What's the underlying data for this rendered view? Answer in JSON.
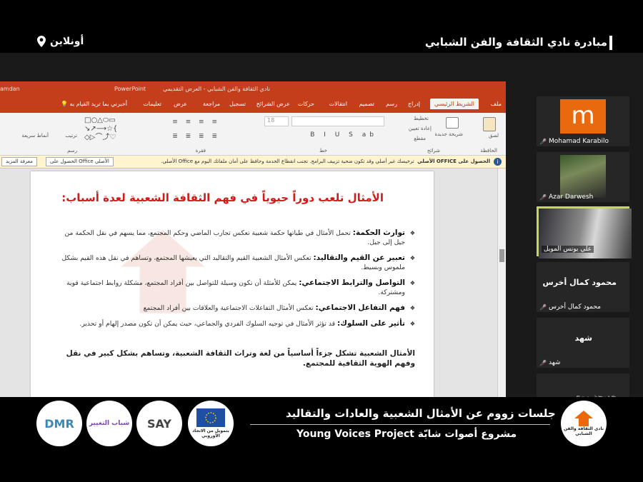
{
  "header": {
    "title": "مبادرة نادي الثقافة والفن الشبابي",
    "online": "أونلاين"
  },
  "ppt": {
    "app_name": "PowerPoint",
    "window_title": "نادي الثقافة والفن الشبابي - العرض التقديمي",
    "user": "amdan",
    "tabs": [
      "ملف",
      "الشريط الرئيسي",
      "إدراج",
      "رسم",
      "تصميم",
      "انتقالات",
      "حركات",
      "عرض الشرائح",
      "تسجيل",
      "مراجعة",
      "عرض",
      "تعليمات"
    ],
    "tell_me": "أخبرني بما تريد القيام به",
    "groups": [
      "الحافظة",
      "شرائح",
      "خط",
      "فقرة",
      "رسم"
    ],
    "ribbon_labels": [
      "لصق",
      "شريحة جديدة",
      "تخطيط",
      "إعادة تعيين",
      "مقطع",
      "ترتيب",
      "أنماط سريعة"
    ],
    "font_size": "18",
    "notice": {
      "bold": "الحصول على OFFICE الأصلي",
      "text": "ترخيصك غير أصلي وقد تكون ضحية تزييف البرامج. تجنب انقطاع الخدمة وحافظ على أمان ملفاتك اليوم مع Office الأصلي.",
      "button1": "الحصول على Office الأصلي",
      "button2": "معرفة المزيد"
    },
    "slide": {
      "title": "الأمثال تلعب دوراً حيوياً في فهم الثقافة الشعبية لعدة أسباب:",
      "bullets": [
        {
          "head": "توارث الحكمة:",
          "text": "تحمل الأمثال في طياتها حكمة شعبية تعكس تجارب الماضي وحكم المجتمع، مما يسهم في نقل الحكمة من جيل إلى جيل."
        },
        {
          "head": "تعبير عن القيم والتقاليد:",
          "text": "تعكس الأمثال الشعبية القيم والتقاليد التي يعيشها المجتمع، وتساهم في نقل هذه القيم بشكل ملموس وبسيط."
        },
        {
          "head": "التواصل والترابط الاجتماعي:",
          "text": "يمكن للأمثلة أن تكون وسيلة للتواصل بين أفراد المجتمع، مشكلة روابط اجتماعية قوية ومشتركة."
        },
        {
          "head": "فهم التفاعل الاجتماعي:",
          "text": "تعكس الأمثال التفاعلات الاجتماعية والعلاقات بين أفراد المجتمع"
        },
        {
          "head": "تأثير على السلوك:",
          "text": "قد تؤثر الأمثال في توجيه السلوك الفردي والجماعي، حيث يمكن أن تكون مصدر إلهام أو تحذير."
        }
      ],
      "summary": "الأمثال الشعبية تشكل جزءاً أساسياً من لغة وتراث الثقافة الشعبية، وتساهم بشكل كبير في نقل وفهم الهوية الثقافية للمجتمع."
    }
  },
  "participants": [
    {
      "name": "Mohamad Karabilo",
      "avatar_letter": "m"
    },
    {
      "name": "Azar Darwesh"
    },
    {
      "name": "علي يونس المويل"
    },
    {
      "name": "محمود كمال أخرس",
      "display": "محمود كمال أخرس"
    },
    {
      "name": "شهد",
      "display": "شهد"
    },
    {
      "name": "خديجة موي"
    }
  ],
  "banner": {
    "line1": "جلسات زووم عن الأمثال الشعبية والعادات والتقاليد",
    "line2": "Young Voices Project مشروع أصوات شابّة",
    "logos": [
      "DMR",
      "شباب التغيير",
      "SAY",
      "بتمويل من الاتحاد الأوروبي",
      "نادي الثقافة والفن الشبابي"
    ]
  },
  "colors": {
    "ppt_accent": "#c43e1c",
    "slide_title": "#d11a1a",
    "active_speaker": "#c8d850",
    "avatar_orange": "#e8690e",
    "mic_muted": "#e02828"
  }
}
